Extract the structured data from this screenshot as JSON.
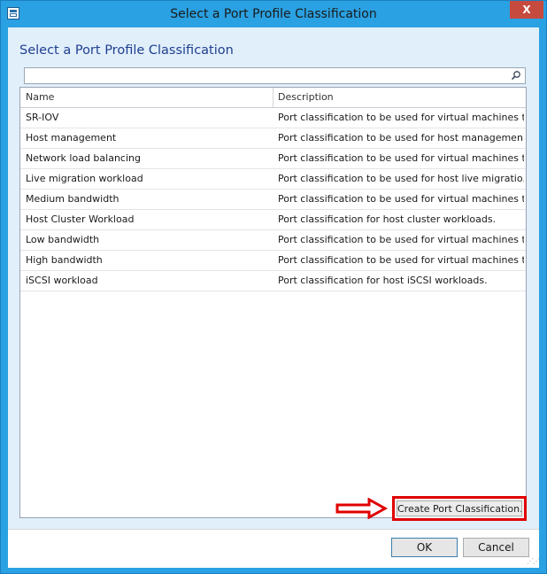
{
  "window": {
    "title": "Select a Port Profile Classification",
    "close_label": "X"
  },
  "dialog": {
    "heading": "Select a Port Profile Classification",
    "search": {
      "value": "",
      "placeholder": ""
    },
    "columns": {
      "name": "Name",
      "description": "Description"
    },
    "rows": [
      {
        "name": "SR-IOV",
        "description": "Port classification to be used for virtual machines t..."
      },
      {
        "name": "Host management",
        "description": "Port classification to be used for host managemen..."
      },
      {
        "name": "Network load balancing",
        "description": "Port classification to be used for virtual machines t..."
      },
      {
        "name": "Live migration  workload",
        "description": "Port classification to be used for host live migratio..."
      },
      {
        "name": "Medium bandwidth",
        "description": "Port classification to be used for virtual machines t..."
      },
      {
        "name": "Host Cluster Workload",
        "description": "Port classification for host cluster workloads."
      },
      {
        "name": "Low bandwidth",
        "description": "Port classification to be used for virtual machines t..."
      },
      {
        "name": "High bandwidth",
        "description": "Port classification to be used for virtual machines t..."
      },
      {
        "name": "iSCSI workload",
        "description": "Port classification for host iSCSI workloads."
      }
    ],
    "create_button": "Create Port Classification...",
    "ok_button": "OK",
    "cancel_button": "Cancel"
  },
  "icons": {
    "window_icon": "app-window-icon",
    "search_icon": "magnifier-icon",
    "annotation_arrow": "red-outline-arrow-icon"
  },
  "colors": {
    "title_bar": "#2aa1e2",
    "content_bg": "#e1effb",
    "heading_text": "#1f3f8f",
    "highlight": "#e00000",
    "close_button": "#c74a3e"
  }
}
